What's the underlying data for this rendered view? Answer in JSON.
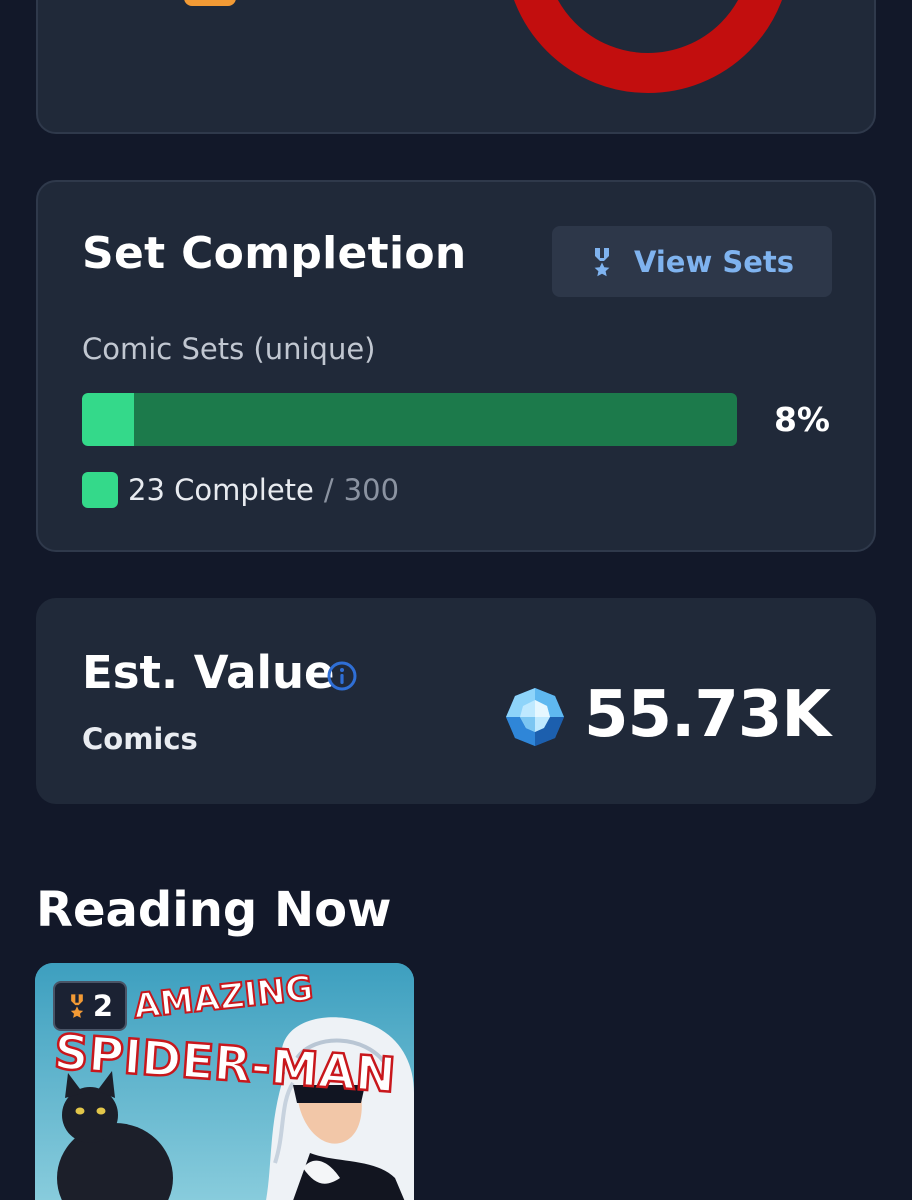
{
  "top_card": {
    "colors": {
      "donut": "#c20e0e",
      "badge": "#f29a35"
    }
  },
  "set_completion": {
    "title": "Set Completion",
    "view_sets_label": "View Sets",
    "subtitle": "Comic Sets (unique)",
    "percent_label": "8%",
    "progress_fraction": 0.08,
    "legend_complete": "23 Complete",
    "legend_separator": "/",
    "legend_total": "300",
    "icons": {
      "view_sets": "medal-icon"
    },
    "colors": {
      "progress_fill": "#34d98a",
      "progress_track": "#1c7a4b",
      "accent": "#7fb3ef"
    }
  },
  "est_value": {
    "title": "Est. Value",
    "subtitle": "Comics",
    "amount": "55.73K",
    "icons": {
      "info": "info-icon",
      "currency": "gem-icon"
    },
    "colors": {
      "info": "#2f6fd6"
    }
  },
  "reading_now": {
    "title": "Reading Now",
    "items": [
      {
        "rank": "2",
        "cover_title": "AMAZING SPIDER-MAN",
        "icons": {
          "rank": "medal-icon"
        }
      }
    ]
  }
}
